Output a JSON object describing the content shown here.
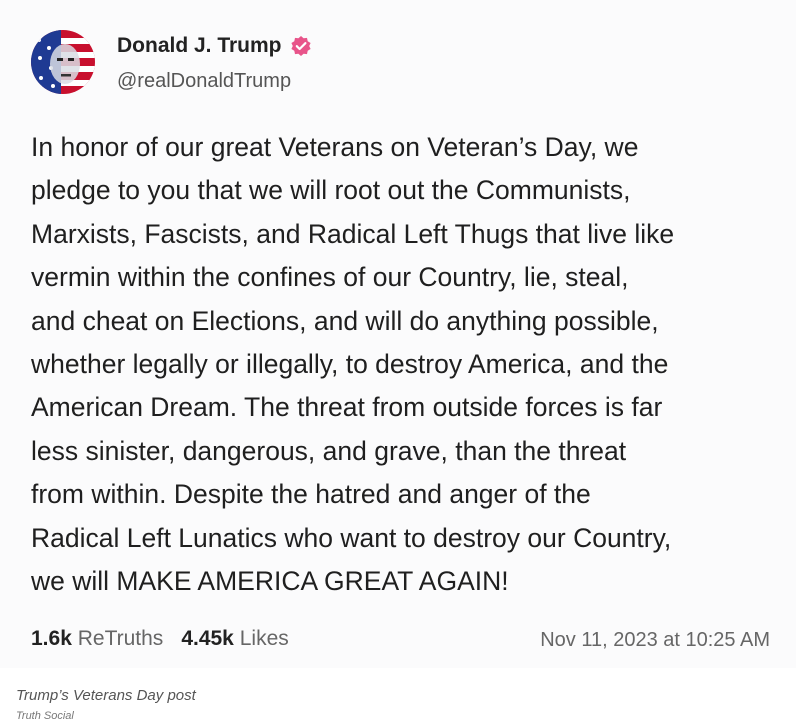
{
  "post": {
    "author_name": "Donald J. Trump",
    "handle": "@realDonaldTrump",
    "verified_icon": "verified-badge-icon",
    "avatar_icon": "profile-avatar",
    "body_lines": [
      "In honor of our great Veterans on Veteran’s Day, we",
      "pledge to you that we will root out the Communists,",
      "Marxists, Fascists, and Radical Left Thugs that live like",
      "vermin within the confines of our Country, lie, steal,",
      "and cheat on Elections, and will do anything possible,",
      "whether legally or illegally, to destroy America, and the",
      "American Dream. The threat from outside forces is far",
      "less sinister, dangerous, and grave, than the threat",
      "from within. Despite the hatred and anger of the",
      "Radical Left Lunatics who want to destroy our Country,",
      "we will MAKE AMERICA GREAT AGAIN!"
    ],
    "retruths_count": "1.6k",
    "retruths_label": "ReTruths",
    "likes_count": "4.45k",
    "likes_label": "Likes",
    "timestamp": "Nov 11, 2023 at 10:25 AM"
  },
  "caption": "Trump’s Veterans Day post",
  "credit": "Truth Social",
  "colors": {
    "verified": "#e8548a",
    "background": "#fbfbfc",
    "text": "#1f1f1f"
  }
}
